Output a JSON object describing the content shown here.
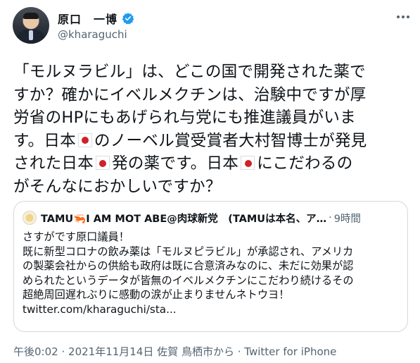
{
  "author": {
    "display_name": "原口　一博",
    "handle": "@kharaguchi",
    "verified": true
  },
  "tweet": {
    "lines": [
      "「モルヌラビル」は、どこの国で開発された薬で",
      "すか？確かにイベルメクチンは、治験中ですが厚",
      "労省のHPにもあげられ与党にも推進議員がいま",
      "す。日本",
      "のノーベル賞受賞者大村智博士が発見",
      "された日本",
      "発の薬です。日本",
      "にこだわるの",
      "がそんなにおかしいですか？"
    ],
    "flag_icon": "japan-flag-emoji"
  },
  "quoted_tweet": {
    "name": "TAMU🦐I AM MOT ABE@肉球新党　(TAMUは本名、ア…",
    "separator": "·",
    "time": "9時間",
    "lines": [
      "さすがです原口議員！",
      "既に新型コロナの飲み薬は「モルヌピラビル」が承認され、アメリカ",
      "の製薬会社からの供給も政府は既に合意済みなのに、未だに効果が認",
      "められたというデータが皆無のイベルメクチンにこだわり続けるその",
      "超絶周回遅れぶりに感動の涙が止まりませんネトウヨ！",
      "twitter.com/kharaguchi/sta..."
    ]
  },
  "meta": {
    "time": "午後0:02",
    "sep1": "·",
    "date": "2021年11月14日",
    "location": "佐賀 鳥栖市から",
    "sep2": "·",
    "source": "Twitter for iPhone"
  },
  "colors": {
    "verified": "#1d9bf0",
    "muted": "#536471",
    "flag_red": "#d0202a"
  }
}
